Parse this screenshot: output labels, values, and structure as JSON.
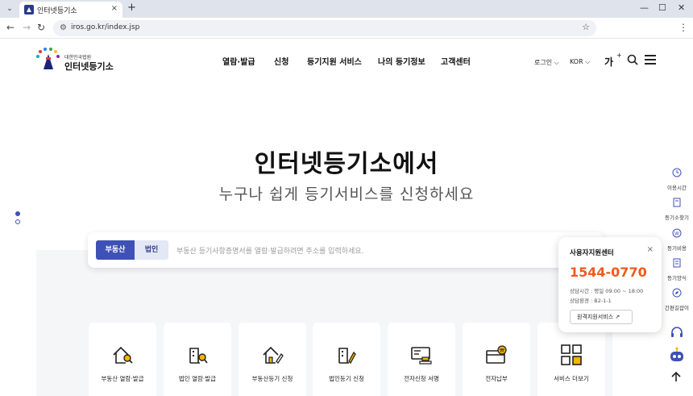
{
  "browser": {
    "tab_title": "인터넷등기소",
    "url": "iros.go.kr/index.jsp",
    "tab_close": "×",
    "new_tab": "+",
    "min": "—",
    "max": "☐",
    "close": "✕"
  },
  "header": {
    "logo_sub": "대한민국법원",
    "logo_main": "인터넷등기소",
    "nav": [
      "열람·발급",
      "신청",
      "등기지원 서비스",
      "나의 등기정보",
      "고객센터"
    ],
    "login": "로그인",
    "lang": "KOR",
    "font_size": "가",
    "font_plus": "+"
  },
  "hero": {
    "title": "인터넷등기소에서",
    "subtitle": "누구나 쉽게 등기서비스를 신청하세요"
  },
  "search": {
    "tab_realestate": "부동산",
    "tab_corp": "법인",
    "placeholder": "부동산 등기사항증명서를 열람·발급하려면 주소를 입력하세요."
  },
  "services": [
    {
      "label": "부동산 열람·발급",
      "icon": "house-search-icon"
    },
    {
      "label": "법인 열람·발급",
      "icon": "building-search-icon"
    },
    {
      "label": "부동산등기 신청",
      "icon": "house-pen-icon"
    },
    {
      "label": "법인등기 신청",
      "icon": "building-pen-icon"
    },
    {
      "label": "전자신청 서명",
      "icon": "sign-card-icon"
    },
    {
      "label": "전자납부",
      "icon": "wallet-won-icon"
    },
    {
      "label": "서비스 더보기",
      "icon": "grid-icon"
    }
  ],
  "popup": {
    "title": "사용자지원센터",
    "close": "×",
    "phone": "1544-0770",
    "hours": "상담시간 : 평일 09:00 ~ 18:00",
    "env": "상담환경 : B2-1-1",
    "button": "원격지원서비스"
  },
  "quick_menu": [
    "이용시간",
    "등기소찾기",
    "등기비용",
    "등기양식",
    "간편길잡이"
  ],
  "colors": {
    "primary": "#3f51b5",
    "accent": "#f05a1a",
    "icon_yellow": "#f5b400"
  }
}
